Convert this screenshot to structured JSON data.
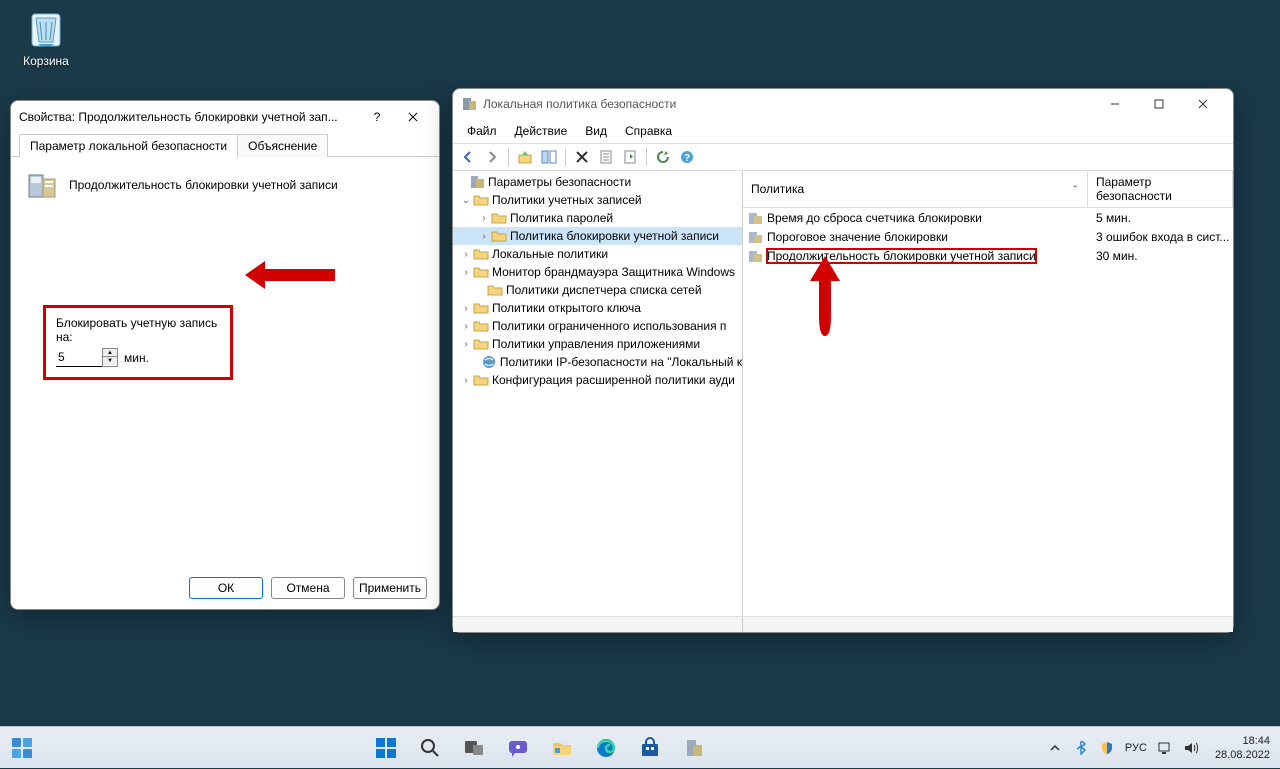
{
  "desktop": {
    "recycle_bin": "Корзина"
  },
  "dialog": {
    "title": "Свойства: Продолжительность блокировки учетной зап...",
    "help": "?",
    "tabs": {
      "local": "Параметр локальной безопасности",
      "explain": "Объяснение"
    },
    "policy_name": "Продолжительность блокировки учетной записи",
    "field_label": "Блокировать учетную запись на:",
    "field_value": "5",
    "field_unit": "мин.",
    "buttons": {
      "ok": "ОК",
      "cancel": "Отмена",
      "apply": "Применить"
    }
  },
  "mmc": {
    "title": "Локальная политика безопасности",
    "menu": {
      "file": "Файл",
      "action": "Действие",
      "view": "Вид",
      "help": "Справка"
    },
    "tree": {
      "root": "Параметры безопасности",
      "account_policies": "Политики учетных записей",
      "password_policy": "Политика паролей",
      "lockout_policy": "Политика блокировки учетной записи",
      "local_policies": "Локальные политики",
      "firewall": "Монитор брандмауэра Защитника Windows",
      "netlist": "Политики диспетчера списка сетей",
      "pubkey": "Политики открытого ключа",
      "software_restrict": "Политики ограниченного использования п",
      "appctrl": "Политики управления приложениями",
      "ipsec": "Политики IP-безопасности на \"Локальный к",
      "advaudit": "Конфигурация расширенной политики ауди"
    },
    "columns": {
      "policy": "Политика",
      "param": "Параметр безопасности"
    },
    "rows": [
      {
        "name": "Время до сброса счетчика блокировки",
        "value": "5 мин."
      },
      {
        "name": "Пороговое значение блокировки",
        "value": "3 ошибок входа в сист..."
      },
      {
        "name": "Продолжительность блокировки учетной записи",
        "value": "30 мин."
      }
    ]
  },
  "tray": {
    "lang": "РУС",
    "time": "18:44",
    "date": "28.08.2022"
  }
}
